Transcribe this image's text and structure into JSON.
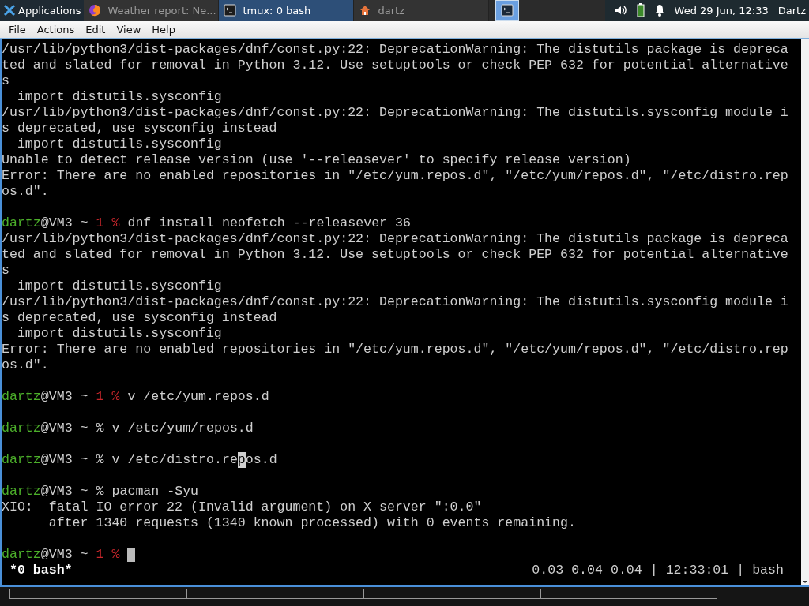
{
  "panel": {
    "menu": "Applications",
    "tasks": [
      {
        "label": "Weather report: Ne...",
        "kind": "browser",
        "selected": false
      },
      {
        "label": "tmux: 0 bash",
        "kind": "terminal",
        "selected": true
      },
      {
        "label": "dartz",
        "kind": "home",
        "selected": false
      }
    ],
    "launcher_selected": true,
    "clock": "Wed 29 Jun, 12:33",
    "user": "Dartz"
  },
  "menubar": [
    "File",
    "Actions",
    "Edit",
    "View",
    "Help"
  ],
  "terminal": {
    "lines": [
      {
        "kind": "output",
        "text": "/usr/lib/python3/dist-packages/dnf/const.py:22: DeprecationWarning: The distutils package is depreca"
      },
      {
        "kind": "output",
        "text": "ted and slated for removal in Python 3.12. Use setuptools or check PEP 632 for potential alternative"
      },
      {
        "kind": "output",
        "text": "s"
      },
      {
        "kind": "output",
        "text": "  import distutils.sysconfig"
      },
      {
        "kind": "output",
        "text": "/usr/lib/python3/dist-packages/dnf/const.py:22: DeprecationWarning: The distutils.sysconfig module i"
      },
      {
        "kind": "output",
        "text": "s deprecated, use sysconfig instead"
      },
      {
        "kind": "output",
        "text": "  import distutils.sysconfig"
      },
      {
        "kind": "output",
        "text": "Unable to detect release version (use '--releasever' to specify release version)"
      },
      {
        "kind": "output",
        "text": "Error: There are no enabled repositories in \"/etc/yum.repos.d\", \"/etc/yum/repos.d\", \"/etc/distro.rep"
      },
      {
        "kind": "output",
        "text": "os.d\"."
      },
      {
        "kind": "blank"
      },
      {
        "kind": "prompt",
        "user": "dartz",
        "host": "@VM3",
        "dir": "~",
        "status": "1",
        "sign": "%",
        "command": [
          {
            "text": "dnf install neofetch --releasever 36",
            "selected": false
          }
        ],
        "cursor": false
      },
      {
        "kind": "output",
        "text": "/usr/lib/python3/dist-packages/dnf/const.py:22: DeprecationWarning: The distutils package is depreca"
      },
      {
        "kind": "output",
        "text": "ted and slated for removal in Python 3.12. Use setuptools or check PEP 632 for potential alternative"
      },
      {
        "kind": "output",
        "text": "s"
      },
      {
        "kind": "output",
        "text": "  import distutils.sysconfig"
      },
      {
        "kind": "output",
        "text": "/usr/lib/python3/dist-packages/dnf/const.py:22: DeprecationWarning: The distutils.sysconfig module i"
      },
      {
        "kind": "output",
        "text": "s deprecated, use sysconfig instead"
      },
      {
        "kind": "output",
        "text": "  import distutils.sysconfig"
      },
      {
        "kind": "output",
        "text": "Error: There are no enabled repositories in \"/etc/yum.repos.d\", \"/etc/yum/repos.d\", \"/etc/distro.rep"
      },
      {
        "kind": "output",
        "text": "os.d\"."
      },
      {
        "kind": "blank"
      },
      {
        "kind": "prompt",
        "user": "dartz",
        "host": "@VM3",
        "dir": "~",
        "status": "1",
        "sign": "%",
        "command": [
          {
            "text": "v /etc/yum.repos.d",
            "selected": false
          }
        ],
        "cursor": false
      },
      {
        "kind": "blank"
      },
      {
        "kind": "prompt",
        "user": "dartz",
        "host": "@VM3",
        "dir": "~",
        "sign": "%",
        "command": [
          {
            "text": "v /etc/yum/repos.d",
            "selected": false
          }
        ],
        "cursor": false
      },
      {
        "kind": "blank"
      },
      {
        "kind": "prompt",
        "user": "dartz",
        "host": "@VM3",
        "dir": "~",
        "sign": "%",
        "command": [
          {
            "text": "v /etc/distro.re",
            "selected": false
          },
          {
            "text": "p",
            "selected": true
          },
          {
            "text": "os.d",
            "selected": false
          }
        ],
        "cursor": false
      },
      {
        "kind": "blank"
      },
      {
        "kind": "prompt",
        "user": "dartz",
        "host": "@VM3",
        "dir": "~",
        "sign": "%",
        "command": [
          {
            "text": "pacman -Syu",
            "selected": false
          }
        ],
        "cursor": false
      },
      {
        "kind": "output",
        "text": "XIO:  fatal IO error 22 (Invalid argument) on X server \":0.0\""
      },
      {
        "kind": "output",
        "text": "      after 1340 requests (1340 known processed) with 0 events remaining."
      },
      {
        "kind": "blank"
      },
      {
        "kind": "prompt",
        "user": "dartz",
        "host": "@VM3",
        "dir": "~",
        "status": "1",
        "sign": "%",
        "cursor": true
      }
    ],
    "status": {
      "session": "*0 bash*",
      "info": "0.03 0.04 0.04 | 12:33:01 | bash"
    }
  }
}
